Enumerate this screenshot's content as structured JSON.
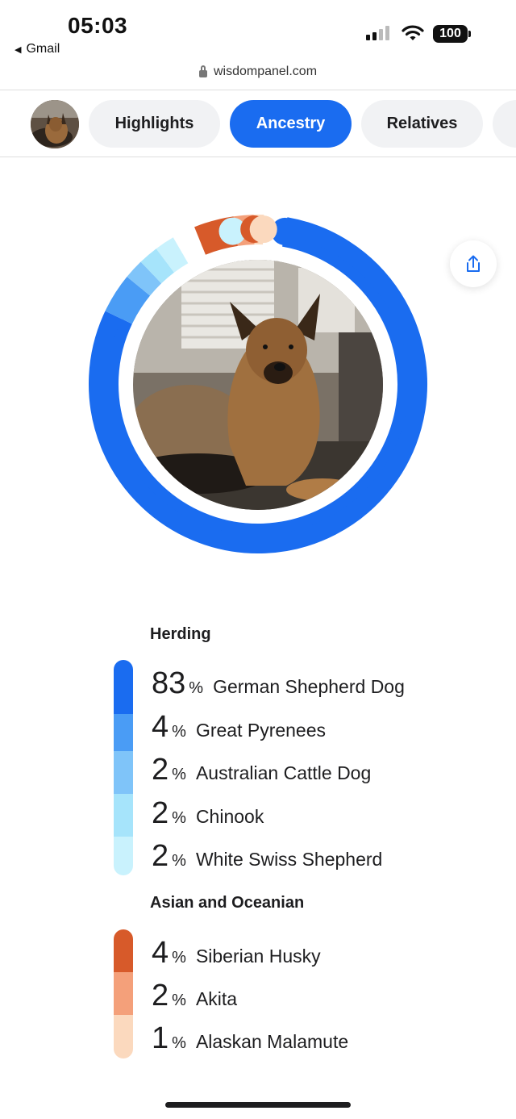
{
  "status_bar": {
    "time": "05:03",
    "back_app": "Gmail",
    "battery": "100"
  },
  "browser": {
    "url": "wisdompanel.com"
  },
  "tabs": [
    {
      "label": "Highlights",
      "active": false
    },
    {
      "label": "Ancestry",
      "active": true
    },
    {
      "label": "Relatives",
      "active": false
    }
  ],
  "ring_segments": [
    {
      "breed": "German Shepherd Dog",
      "percent": 83,
      "color": "#1a6cf0"
    },
    {
      "breed": "Great Pyrenees",
      "percent": 4,
      "color": "#4a9cf5"
    },
    {
      "breed": "Australian Cattle Dog",
      "percent": 2,
      "color": "#7fc4f9"
    },
    {
      "breed": "Chinook",
      "percent": 2,
      "color": "#a6e4fb"
    },
    {
      "breed": "White Swiss Shepherd",
      "percent": 2,
      "color": "#c9f2fd"
    },
    {
      "breed": "Siberian Husky",
      "percent": 4,
      "color": "#d75a2a"
    },
    {
      "breed": "Akita",
      "percent": 2,
      "color": "#f4a07a"
    },
    {
      "breed": "Alaskan Malamute",
      "percent": 1,
      "color": "#fbd9be"
    }
  ],
  "groups": [
    {
      "title": "Herding",
      "colors": [
        "#1a6cf0",
        "#4a9cf5",
        "#7fc4f9",
        "#a6e4fb",
        "#c9f2fd"
      ],
      "breeds": [
        {
          "percent": "83",
          "name": "German Shepherd Dog"
        },
        {
          "percent": "4",
          "name": "Great Pyrenees"
        },
        {
          "percent": "2",
          "name": "Australian Cattle Dog"
        },
        {
          "percent": "2",
          "name": "Chinook"
        },
        {
          "percent": "2",
          "name": "White Swiss Shepherd"
        }
      ]
    },
    {
      "title": "Asian and Oceanian",
      "colors": [
        "#d75a2a",
        "#f4a07a",
        "#fbd9be"
      ],
      "breeds": [
        {
          "percent": "4",
          "name": "Siberian Husky"
        },
        {
          "percent": "2",
          "name": "Akita"
        },
        {
          "percent": "1",
          "name": "Alaskan Malamute"
        }
      ]
    }
  ],
  "percent_sign": "%",
  "icons": {
    "share": "share-icon",
    "lock": "lock-icon",
    "back": "back-triangle-icon",
    "signal": "cell-signal-icon",
    "wifi": "wifi-icon",
    "battery": "battery-icon"
  }
}
